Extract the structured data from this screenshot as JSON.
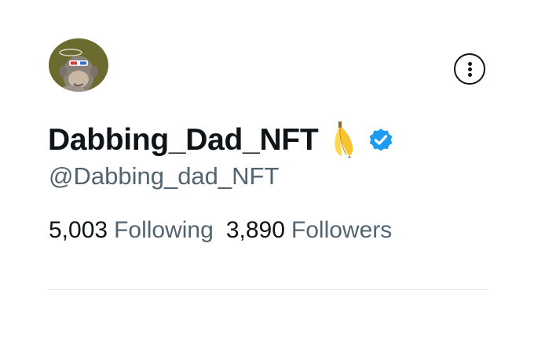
{
  "profile": {
    "display_name": "Dabbing_Dad_NFT",
    "handle": "@Dabbing_dad_NFT",
    "name_emoji": "banana",
    "verified_badge_color": "#1d9bf0",
    "avatar_background": "#6b6a2f"
  },
  "stats": {
    "following_count": "5,003",
    "following_label": "Following",
    "followers_count": "3,890",
    "followers_label": "Followers"
  },
  "icons": {
    "more": "more-options-icon",
    "verified": "verified-badge-icon",
    "banana": "banana-emoji-icon"
  },
  "colors": {
    "text_primary": "#0f1419",
    "text_secondary": "#536471",
    "divider": "#e7e9ea"
  }
}
